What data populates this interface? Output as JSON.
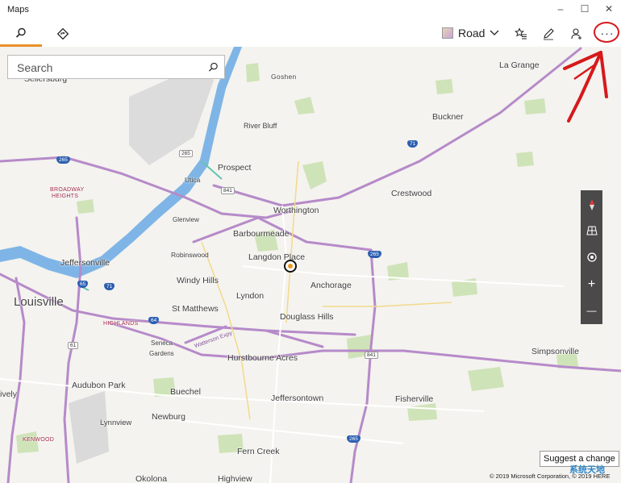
{
  "window": {
    "title": "Maps",
    "minimize_glyph": "–",
    "maximize_glyph": "☐",
    "close_glyph": "✕"
  },
  "toolbar": {
    "search_tab_icon": "search-icon",
    "directions_tab_icon": "directions-icon",
    "map_style_label": "Road",
    "favorites_icon": "favorites-icon",
    "ink_icon": "pen-icon",
    "account_icon": "person-icon",
    "more_label": "···"
  },
  "search": {
    "placeholder": "Search"
  },
  "map": {
    "labels": {
      "sellersburg": "Sellersburg",
      "goshen": "Goshen",
      "la_grange": "La Grange",
      "river_bluff": "River Bluff",
      "buckner": "Buckner",
      "prospect": "Prospect",
      "utica": "Utica",
      "broadway": "BROADWAY",
      "heights": "HEIGHTS",
      "crestwood": "Crestwood",
      "worthington": "Worthington",
      "glenview": "Glenview",
      "barbourmeade": "Barbourmeade",
      "robinswood": "Robinswood",
      "langdon_place": "Langdon Place",
      "jeffersonville": "Jeffersonville",
      "windy_hills": "Windy Hills",
      "anchorage": "Anchorage",
      "louisville": "Louisville",
      "lyndon": "Lyndon",
      "st_matthews": "St Matthews",
      "douglass_hills": "Douglass Hills",
      "highlands": "HIGHLANDS",
      "seneca_gardens_1": "Seneca",
      "seneca_gardens_2": "Gardens",
      "watterson": "Watterson Expy",
      "hurstbourne": "Hurstbourne Acres",
      "simpsonville": "Simpsonville",
      "audubon_park": "Audubon Park",
      "buechel": "Buechel",
      "jeffersontown": "Jeffersontown",
      "fisherville": "Fisherville",
      "ively": "ively",
      "lynnview": "Lynnview",
      "newburg": "Newburg",
      "kenwood": "KENWOOD",
      "fern_creek": "Fern Creek",
      "okolona": "Okolona",
      "highview": "Highview"
    },
    "shields": {
      "i265_nw": "265",
      "r265": "265",
      "i71_ne": "71",
      "r841_n": "841",
      "i265_c": "265",
      "i65": "65",
      "i71_w": "71",
      "i64": "64",
      "r61": "61",
      "r841_s": "841",
      "i265_s": "265"
    }
  },
  "controls": {
    "compass_icon": "compass-icon",
    "tilt_icon": "3d-tilt-icon",
    "locate_icon": "locate-me-icon",
    "zoom_in_label": "+",
    "zoom_out_label": "—"
  },
  "suggest_change": "Suggest a change",
  "copyright": "© 2019 Microsoft Corporation, © 2019 HERE",
  "watermark": "系统天地",
  "annotation_color": "#d6191b",
  "accent_color": "#e8902a"
}
